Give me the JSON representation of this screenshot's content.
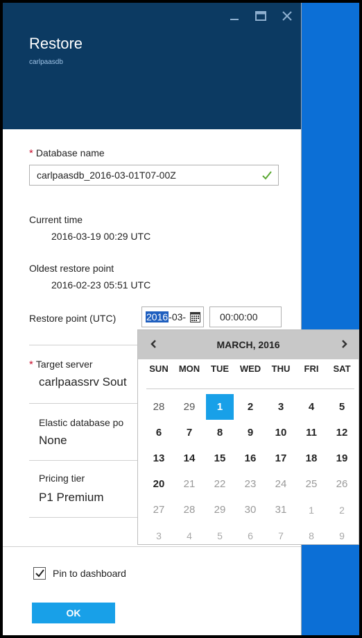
{
  "blade": {
    "title": "Restore",
    "subtitle": "carlpaasdb",
    "window_controls": [
      "minimize-icon",
      "maximize-icon",
      "close-icon"
    ]
  },
  "database_name": {
    "required_mark": "*",
    "label": "Database name",
    "value": "carlpaasdb_2016-03-01T07-00Z",
    "valid_icon": "checkmark-icon"
  },
  "current_time": {
    "label": "Current time",
    "value": "2016-03-19 00:29 UTC"
  },
  "oldest_restore_point": {
    "label": "Oldest restore point",
    "value": "2016-02-23 05:51 UTC"
  },
  "restore_point": {
    "label": "Restore point (UTC)",
    "date_selected": "2016",
    "date_rest": "-03-",
    "time_value": "00:00:00",
    "calendar_icon": "calendar-icon"
  },
  "target_server": {
    "required_mark": "*",
    "label": "Target server",
    "value": "carlpaassrv Sout"
  },
  "elastic_pool": {
    "label": "Elastic database po",
    "value": "None"
  },
  "pricing_tier": {
    "label": "Pricing tier",
    "value": "P1 Premium"
  },
  "calendar": {
    "month_label": "MARCH, 2016",
    "prev_icon": "chevron-left-icon",
    "next_icon": "chevron-right-icon",
    "weekdays": [
      "SUN",
      "MON",
      "TUE",
      "WED",
      "THU",
      "FRI",
      "SAT"
    ],
    "weeks": [
      [
        {
          "d": "28",
          "t": "past"
        },
        {
          "d": "29",
          "t": "past"
        },
        {
          "d": "1",
          "t": "sel"
        },
        {
          "d": "2",
          "t": "in"
        },
        {
          "d": "3",
          "t": "in"
        },
        {
          "d": "4",
          "t": "in"
        },
        {
          "d": "5",
          "t": "in"
        }
      ],
      [
        {
          "d": "6",
          "t": "in"
        },
        {
          "d": "7",
          "t": "in"
        },
        {
          "d": "8",
          "t": "in"
        },
        {
          "d": "9",
          "t": "in"
        },
        {
          "d": "10",
          "t": "in"
        },
        {
          "d": "11",
          "t": "in"
        },
        {
          "d": "12",
          "t": "in"
        }
      ],
      [
        {
          "d": "13",
          "t": "in"
        },
        {
          "d": "14",
          "t": "in"
        },
        {
          "d": "15",
          "t": "in"
        },
        {
          "d": "16",
          "t": "in"
        },
        {
          "d": "17",
          "t": "in"
        },
        {
          "d": "18",
          "t": "in"
        },
        {
          "d": "19",
          "t": "in"
        }
      ],
      [
        {
          "d": "20",
          "t": "in"
        },
        {
          "d": "21",
          "t": "future"
        },
        {
          "d": "22",
          "t": "future"
        },
        {
          "d": "23",
          "t": "future"
        },
        {
          "d": "24",
          "t": "future"
        },
        {
          "d": "25",
          "t": "future"
        },
        {
          "d": "26",
          "t": "future"
        }
      ],
      [
        {
          "d": "27",
          "t": "future"
        },
        {
          "d": "28",
          "t": "future"
        },
        {
          "d": "29",
          "t": "future"
        },
        {
          "d": "30",
          "t": "future"
        },
        {
          "d": "31",
          "t": "future"
        },
        {
          "d": "1",
          "t": "out"
        },
        {
          "d": "2",
          "t": "out"
        }
      ],
      [
        {
          "d": "3",
          "t": "out"
        },
        {
          "d": "4",
          "t": "out"
        },
        {
          "d": "5",
          "t": "out"
        },
        {
          "d": "6",
          "t": "out"
        },
        {
          "d": "7",
          "t": "out"
        },
        {
          "d": "8",
          "t": "out"
        },
        {
          "d": "9",
          "t": "out"
        }
      ]
    ]
  },
  "pin_to_dashboard": {
    "label": "Pin to dashboard",
    "checked": true
  },
  "ok_button": {
    "label": "OK"
  },
  "colors": {
    "header": "#0c3a62",
    "accent": "#18a0e8",
    "background_blue": "#0c6fd6",
    "required": "#c8102e",
    "valid": "#5aa832"
  }
}
